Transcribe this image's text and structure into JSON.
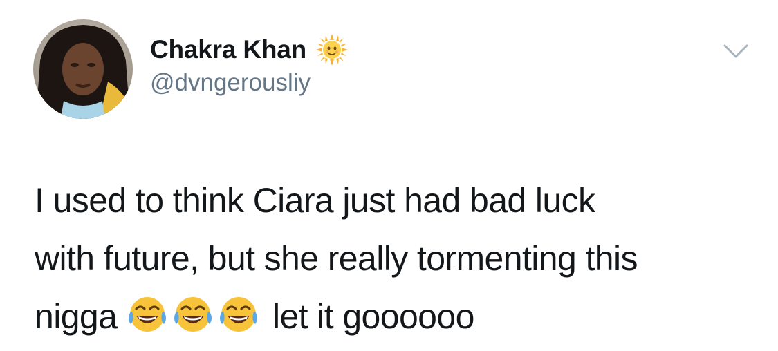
{
  "tweet": {
    "author": {
      "display_name": "Chakra Khan",
      "name_emoji": "sun-with-face",
      "handle": "@dvngerousliy"
    },
    "menu_icon": "chevron-down-icon",
    "text_lines": [
      "I used to think Ciara just had bad luck",
      "with future, but she really tormenting this",
      "nigga",
      "let it goooooo"
    ],
    "inline_emojis": [
      "face-with-tears-of-joy",
      "face-with-tears-of-joy",
      "face-with-tears-of-joy"
    ]
  },
  "colors": {
    "text_primary": "#14171a",
    "text_secondary": "#657786",
    "background": "#ffffff",
    "emoji_yellow": "#f7c33a",
    "tear_blue": "#5aa8e6"
  }
}
